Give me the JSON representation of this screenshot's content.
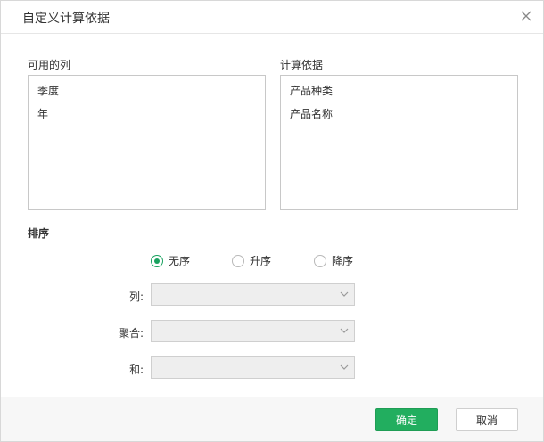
{
  "dialog": {
    "title": "自定义计算依据",
    "close_icon": "close-icon"
  },
  "available_columns": {
    "label": "可用的列",
    "items": [
      "季度",
      "年"
    ]
  },
  "calc_basis": {
    "label": "计算依据",
    "items": [
      "产品种类",
      "产品名称"
    ]
  },
  "sort": {
    "label": "排序",
    "options": [
      {
        "label": "无序",
        "checked": true
      },
      {
        "label": "升序",
        "checked": false
      },
      {
        "label": "降序",
        "checked": false
      }
    ]
  },
  "fields": {
    "column_label": "列:",
    "aggregate_label": "聚合:",
    "sum_label": "和:"
  },
  "footer": {
    "ok_label": "确定",
    "cancel_label": "取消"
  },
  "colors": {
    "accent": "#22ae5f",
    "radio_checked": "#1aa260"
  }
}
